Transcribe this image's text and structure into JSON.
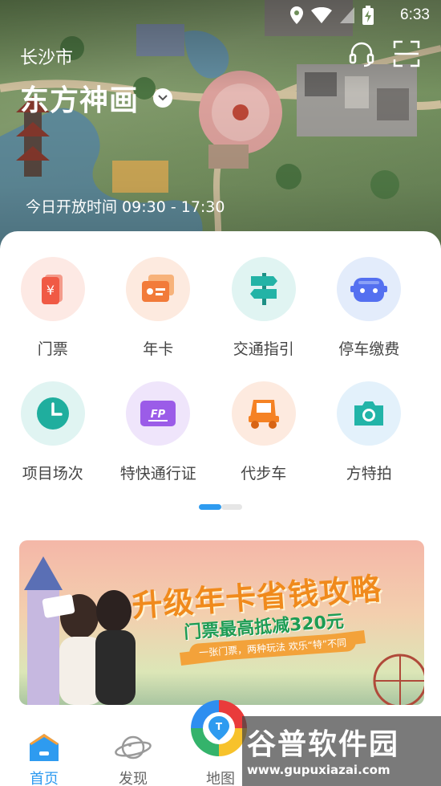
{
  "status_bar": {
    "time": "6:33"
  },
  "header": {
    "city": "长沙市",
    "park_name": "东方神画",
    "open_hours": "今日开放时间 09:30 - 17:30"
  },
  "services": [
    {
      "label": "门票",
      "icon": "ticket-icon",
      "bg": "#fde9e4",
      "color": "#f05a45"
    },
    {
      "label": "年卡",
      "icon": "annual-card-icon",
      "bg": "#fdeadf",
      "color": "#f27b3a"
    },
    {
      "label": "交通指引",
      "icon": "signpost-icon",
      "bg": "#e0f4f2",
      "color": "#23b3a6"
    },
    {
      "label": "停车缴费",
      "icon": "parking-car-icon",
      "bg": "#e3ecfb",
      "color": "#5470f0"
    },
    {
      "label": "项目场次",
      "icon": "clock-icon",
      "bg": "#e0f4f2",
      "color": "#1fae9e"
    },
    {
      "label": "特快通行证",
      "icon": "fast-pass-icon",
      "bg": "#efe5fb",
      "color": "#9b5ce8"
    },
    {
      "label": "代步车",
      "icon": "cart-icon",
      "bg": "#fdeadf",
      "color": "#f58224"
    },
    {
      "label": "方特拍",
      "icon": "camera-icon",
      "bg": "#e3f1fb",
      "color": "#22b4a8"
    }
  ],
  "banner": {
    "title": "升级年卡省钱攻略",
    "subtitle": "门票最高抵减320元",
    "tagline": "一张门票，两种玩法 欢乐“特”不同"
  },
  "tabbar": {
    "home": "首页",
    "discover": "发现",
    "map": "地图"
  },
  "watermark": {
    "text": "谷普软件园",
    "url": "www.gupuxiazai.com"
  },
  "colors": {
    "accent": "#2e9bf0"
  }
}
